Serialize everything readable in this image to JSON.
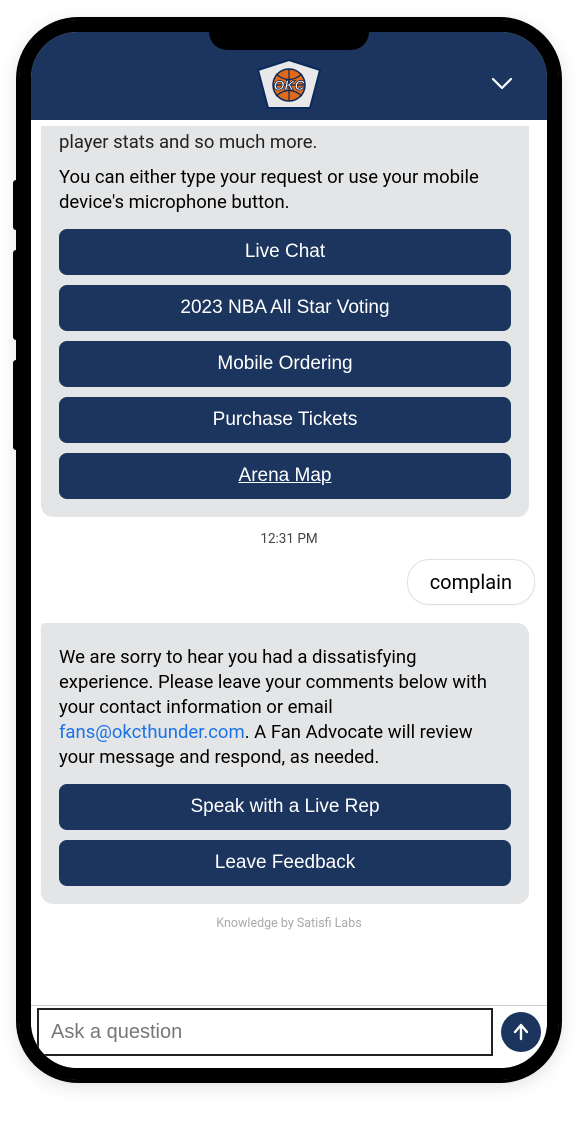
{
  "header": {
    "team_logo_label": "OKC"
  },
  "bot1": {
    "truncated_line": "player stats and so much more.",
    "intro": "You can either type your request or use your mobile device's microphone button.",
    "buttons": [
      "Live Chat",
      "2023 NBA All Star Voting",
      "Mobile Ordering",
      "Purchase Tickets",
      "Arena Map"
    ]
  },
  "timestamp": "12:31 PM",
  "user_message": "complain",
  "bot2": {
    "text_before_email": "We are sorry to hear you had a dissatisfying experience. Please leave your comments below with your contact information or email ",
    "email": "fans@okcthunder.com",
    "text_after_email": ". A Fan Advocate will review your message and respond, as needed.",
    "buttons": [
      "Speak with a Live Rep",
      "Leave Feedback"
    ]
  },
  "attribution": "Knowledge by Satisfi Labs",
  "input": {
    "placeholder": "Ask a question"
  },
  "colors": {
    "primary": "#1c355e",
    "link": "#1a73e8",
    "bubble": "#e4e5e6"
  }
}
